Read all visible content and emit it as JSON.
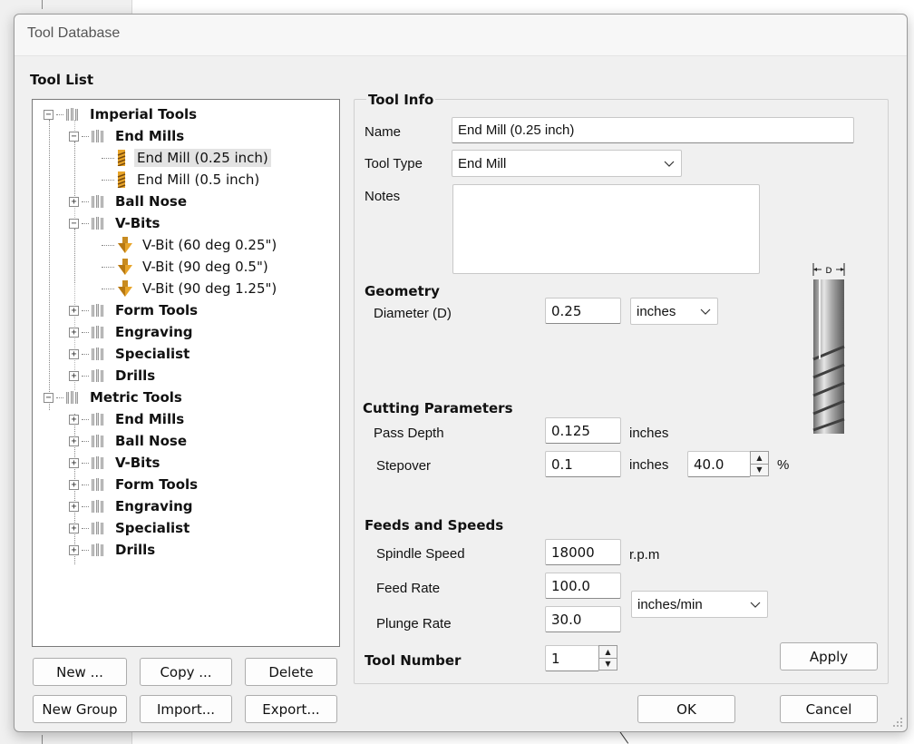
{
  "window": {
    "title": "Tool Database"
  },
  "tool_list": {
    "heading": "Tool List",
    "tree": [
      {
        "label": "Imperial Tools",
        "type": "group",
        "level": 0,
        "expanded": true
      },
      {
        "label": "End Mills",
        "type": "group",
        "level": 1,
        "expanded": true
      },
      {
        "label": "End Mill (0.25 inch)",
        "type": "endmill",
        "level": 2,
        "selected": true
      },
      {
        "label": "End Mill (0.5 inch)",
        "type": "endmill",
        "level": 2
      },
      {
        "label": "Ball Nose",
        "type": "group",
        "level": 1,
        "expanded": false
      },
      {
        "label": "V-Bits",
        "type": "group",
        "level": 1,
        "expanded": true
      },
      {
        "label": "V-Bit (60 deg 0.25\")",
        "type": "vbit",
        "level": 2
      },
      {
        "label": "V-Bit (90 deg 0.5\")",
        "type": "vbit",
        "level": 2
      },
      {
        "label": "V-Bit (90 deg 1.25\")",
        "type": "vbit",
        "level": 2
      },
      {
        "label": "Form Tools",
        "type": "group",
        "level": 1,
        "expanded": false
      },
      {
        "label": "Engraving",
        "type": "group",
        "level": 1,
        "expanded": false
      },
      {
        "label": "Specialist",
        "type": "group",
        "level": 1,
        "expanded": false
      },
      {
        "label": "Drills",
        "type": "group",
        "level": 1,
        "expanded": false
      },
      {
        "label": "Metric Tools",
        "type": "group",
        "level": 0,
        "expanded": true
      },
      {
        "label": "End Mills",
        "type": "group",
        "level": 1,
        "expanded": false
      },
      {
        "label": "Ball Nose",
        "type": "group",
        "level": 1,
        "expanded": false
      },
      {
        "label": "V-Bits",
        "type": "group",
        "level": 1,
        "expanded": false
      },
      {
        "label": "Form Tools",
        "type": "group",
        "level": 1,
        "expanded": false
      },
      {
        "label": "Engraving",
        "type": "group",
        "level": 1,
        "expanded": false
      },
      {
        "label": "Specialist",
        "type": "group",
        "level": 1,
        "expanded": false
      },
      {
        "label": "Drills",
        "type": "group",
        "level": 1,
        "expanded": false
      }
    ],
    "buttons": {
      "new": "New ...",
      "copy": "Copy ...",
      "delete": "Delete",
      "new_group": "New Group",
      "import": "Import...",
      "export": "Export..."
    }
  },
  "tool_info": {
    "heading": "Tool Info",
    "name_label": "Name",
    "name_value": "End Mill (0.25 inch)",
    "type_label": "Tool Type",
    "type_value": "End Mill",
    "notes_label": "Notes",
    "notes_value": ""
  },
  "geometry": {
    "heading": "Geometry",
    "diameter_label": "Diameter (D)",
    "diameter_value": "0.25",
    "units_value": "inches",
    "diagram_label": "D"
  },
  "cutting": {
    "heading": "Cutting Parameters",
    "pass_depth_label": "Pass Depth",
    "pass_depth_value": "0.125",
    "pass_depth_units": "inches",
    "stepover_label": "Stepover",
    "stepover_value": "0.1",
    "stepover_units": "inches",
    "stepover_percent": "40.0",
    "percent_sign": "%"
  },
  "feeds": {
    "heading": "Feeds and Speeds",
    "spindle_label": "Spindle Speed",
    "spindle_value": "18000",
    "spindle_units": "r.p.m",
    "feed_label": "Feed Rate",
    "feed_value": "100.0",
    "plunge_label": "Plunge Rate",
    "plunge_value": "30.0",
    "rate_units": "inches/min"
  },
  "tool_number": {
    "label": "Tool Number",
    "value": "1"
  },
  "actions": {
    "apply": "Apply",
    "ok": "OK",
    "cancel": "Cancel"
  }
}
